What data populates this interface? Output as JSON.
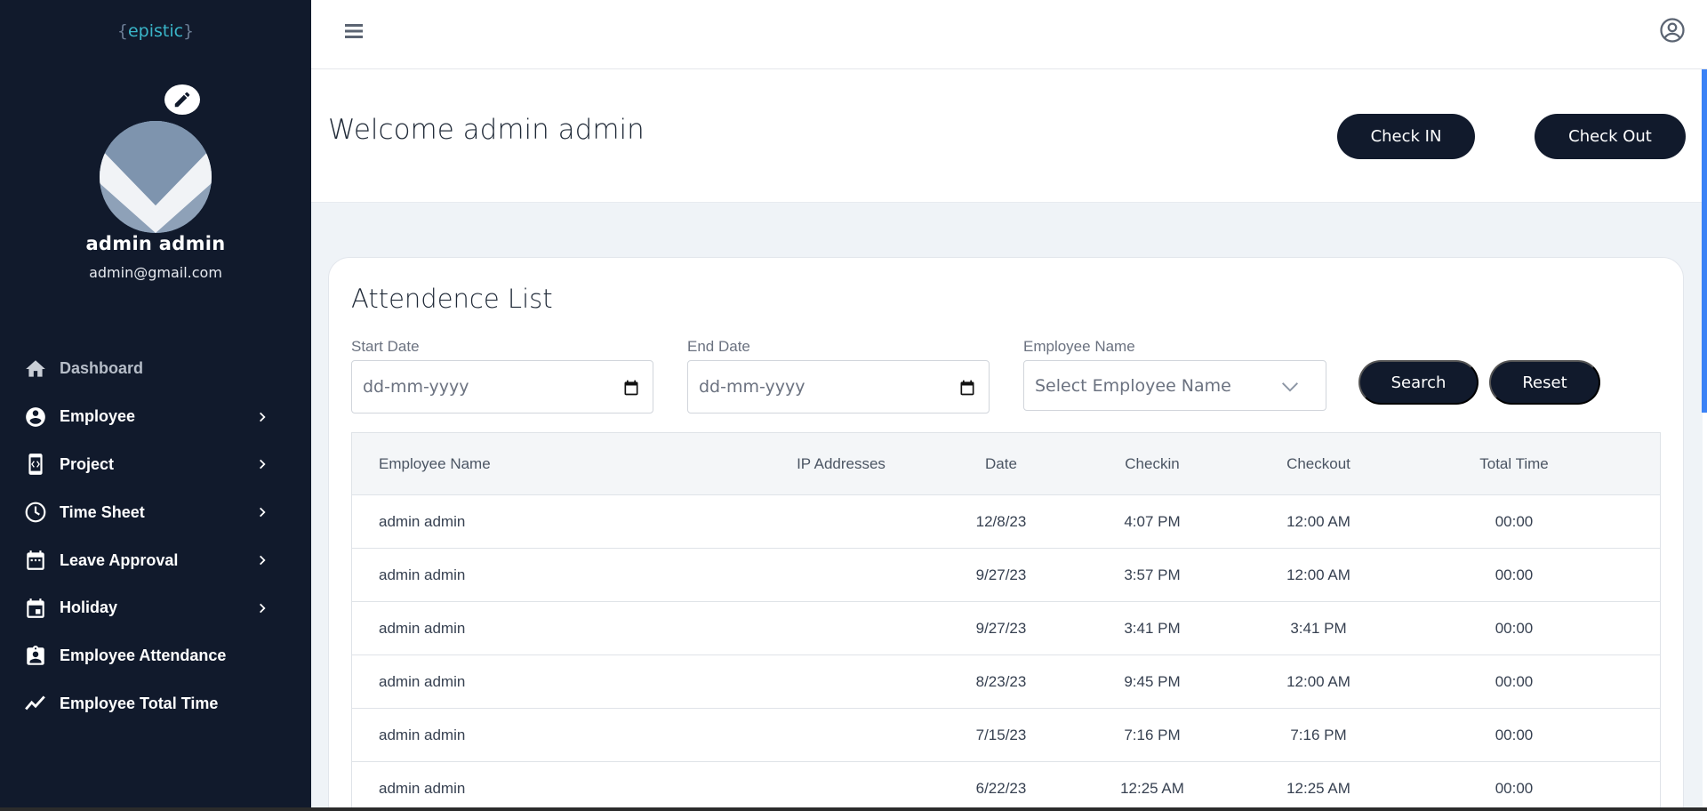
{
  "sidebar": {
    "brand": "epistic",
    "user": {
      "name": "admin admin",
      "email": "admin@gmail.com"
    },
    "items": [
      {
        "label": "Dashboard",
        "icon": "home-icon",
        "chevron": false
      },
      {
        "label": "Employee",
        "icon": "account-circle-icon",
        "chevron": true
      },
      {
        "label": "Project",
        "icon": "code-phone-icon",
        "chevron": true
      },
      {
        "label": "Time Sheet",
        "icon": "clock-icon",
        "chevron": true
      },
      {
        "label": "Leave Approval",
        "icon": "calendar-icon",
        "chevron": true
      },
      {
        "label": "Holiday",
        "icon": "event-icon",
        "chevron": true
      },
      {
        "label": "Employee Attendance",
        "icon": "badge-icon",
        "chevron": false
      },
      {
        "label": "Employee Total Time",
        "icon": "trending-icon",
        "chevron": false
      }
    ]
  },
  "header": {
    "welcome": "Welcome admin admin",
    "check_in_label": "Check IN",
    "check_out_label": "Check Out"
  },
  "attendance": {
    "title": "Attendence List",
    "filters": {
      "start_date_label": "Start Date",
      "start_date_placeholder": "dd-mm-yyyy",
      "end_date_label": "End Date",
      "end_date_placeholder": "dd-mm-yyyy",
      "employee_label": "Employee Name",
      "employee_placeholder": "Select Employee Name",
      "search_label": "Search",
      "reset_label": "Reset"
    },
    "columns": [
      "Employee Name",
      "IP Addresses",
      "Date",
      "Checkin",
      "Checkout",
      "Total Time"
    ],
    "rows": [
      {
        "name": "admin admin",
        "ip": "",
        "date": "12/8/23",
        "checkin": "4:07 PM",
        "checkout": "12:00 AM",
        "total": "00:00"
      },
      {
        "name": "admin admin",
        "ip": "",
        "date": "9/27/23",
        "checkin": "3:57 PM",
        "checkout": "12:00 AM",
        "total": "00:00"
      },
      {
        "name": "admin admin",
        "ip": "",
        "date": "9/27/23",
        "checkin": "3:41 PM",
        "checkout": "3:41 PM",
        "total": "00:00"
      },
      {
        "name": "admin admin",
        "ip": "",
        "date": "8/23/23",
        "checkin": "9:45 PM",
        "checkout": "12:00 AM",
        "total": "00:00"
      },
      {
        "name": "admin admin",
        "ip": "",
        "date": "7/15/23",
        "checkin": "7:16 PM",
        "checkout": "7:16 PM",
        "total": "00:00"
      },
      {
        "name": "admin admin",
        "ip": "",
        "date": "6/22/23",
        "checkin": "12:25 AM",
        "checkout": "12:25 AM",
        "total": "00:00"
      }
    ]
  },
  "colors": {
    "sidebar_bg": "#111a2c",
    "brand": "#3ab6c9",
    "accent": "#3b82f6",
    "content_bg": "#eff3f7"
  }
}
